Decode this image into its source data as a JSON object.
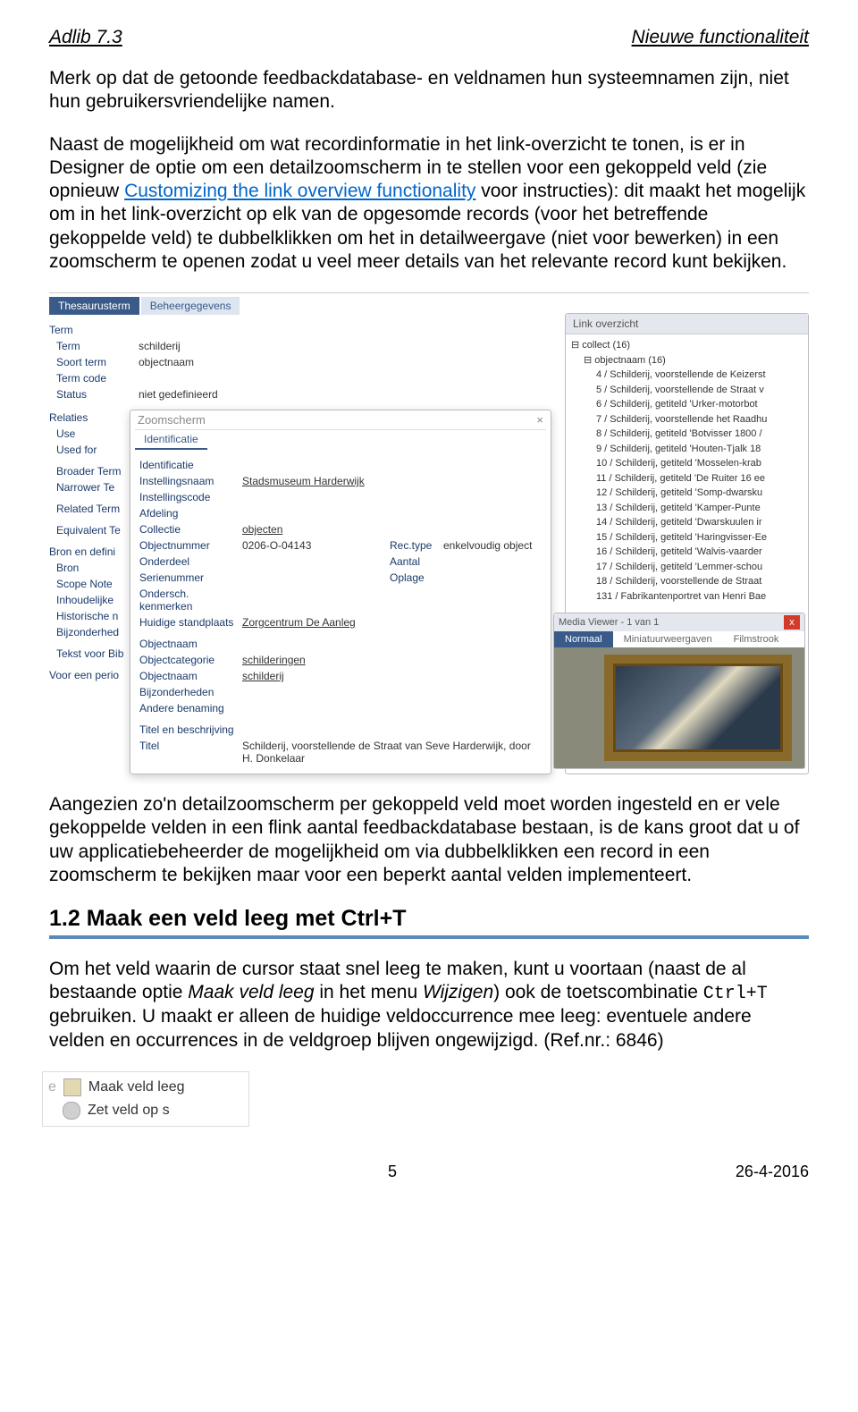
{
  "header": {
    "left": "Adlib 7.3",
    "right": "Nieuwe functionaliteit"
  },
  "paragraph1": "Merk op dat de getoonde feedbackdatabase- en veldnamen hun systeemnamen zijn, niet hun gebruikersvriendelijke namen.",
  "p2a": "Naast de mogelijkheid om wat recordinformatie in het link-overzicht te tonen, is er in Designer de optie om een detailzoomscherm in te stellen voor een gekoppeld veld (zie opnieuw ",
  "p2link": "Customizing the link overview functionality",
  "p2b": " voor instructies): dit maakt het mogelijk om in het link-overzicht op elk van de opgesomde records (voor het betreffende gekoppelde veld) te dubbelklikken om het in detailweergave (niet voor bewerken) in een zoomscherm te openen zodat u veel meer details van het relevante record kunt bekijken.",
  "screenshot": {
    "tab1": "Thesaurusterm",
    "tab2": "Beheergegevens",
    "leftLabels": {
      "l0": "Term",
      "l1": "Term",
      "l2": "Soort term",
      "l3": "Term code",
      "l4": "Status",
      "l5": "Relaties",
      "l6": "Use",
      "l7": "Used for",
      "l8": "Broader Term",
      "l9": "Narrower Te",
      "l10": "Related Term",
      "l11": "Equivalent Te",
      "l12": "Bron en defini",
      "l13": "Bron",
      "l14": "Scope Note",
      "l15": "Inhoudelijke",
      "l16": "Historische n",
      "l17": "Bijzonderhed",
      "l18": "Tekst voor Bib",
      "l19": "Voor een perio"
    },
    "midVals": {
      "v0": "schilderij",
      "v1": "objectnaam",
      "v2": "niet gedefinieerd"
    },
    "zoom": {
      "title": "Zoomscherm",
      "tab": "Identificatie",
      "row0": {
        "label": "Identificatie"
      },
      "row1": {
        "label": "Instellingsnaam",
        "val": "Stadsmuseum Harderwijk"
      },
      "row2": {
        "label": "Instellingscode"
      },
      "row3": {
        "label": "Afdeling"
      },
      "row4": {
        "label": "Collectie",
        "val": "objecten"
      },
      "row5": {
        "label": "Objectnummer",
        "val": "0206-O-04143",
        "l2": "Rec.type",
        "v2": "enkelvoudig object"
      },
      "row6": {
        "label": "Onderdeel",
        "l2": "Aantal"
      },
      "row7": {
        "label": "Serienummer",
        "l2": "Oplage"
      },
      "row8": {
        "label": "Ondersch. kenmerken"
      },
      "row9": {
        "label": "Huidige standplaats",
        "val": "Zorgcentrum De Aanleg"
      },
      "row10": {
        "label": "Objectnaam"
      },
      "row11": {
        "label": "Objectcategorie",
        "val": "schilderingen"
      },
      "row12": {
        "label": "Objectnaam",
        "val": "schilderij"
      },
      "row13": {
        "label": "Bijzonderheden"
      },
      "row14": {
        "label": "Andere benaming"
      },
      "row15": {
        "label": "Titel en beschrijving"
      },
      "row16": {
        "label": "Titel",
        "val": "Schilderij, voorstellende de Straat van Seve Harderwijk, door H. Donkelaar"
      }
    },
    "panelHead": "Link overzicht",
    "tree": {
      "r0": "collect (16)",
      "r1": "objectnaam (16)",
      "i0": "4 / Schilderij, voorstellende de Keizerst",
      "i1": "5 / Schilderij, voorstellende de Straat v",
      "i2": "6 / Schilderij, getiteld 'Urker-motorbot",
      "i3": "7 / Schilderij, voorstellende het Raadhu",
      "i4": "8 / Schilderij, getiteld 'Botvisser 1800 /",
      "i5": "9 / Schilderij, getiteld 'Houten-Tjalk 18",
      "i6": "10 / Schilderij, getiteld 'Mosselen-krab",
      "i7": "11 / Schilderij, getiteld 'De Ruiter 16 ee",
      "i8": "12 / Schilderij, getiteld 'Somp-dwarsku",
      "i9": "13 / Schilderij, getiteld 'Kamper-Punte",
      "i10": "14 / Schilderij, getiteld 'Dwarskuulen ir",
      "i11": "15 / Schilderij, getiteld 'Haringvisser-Ee",
      "i12": "16 / Schilderij, getiteld 'Walvis-vaarder",
      "i13": "17 / Schilderij, getiteld 'Lemmer-schou",
      "i14": "18 / Schilderij, voorstellende de Straat",
      "i15": "131 / Fabrikantenportret van Henri Bae"
    },
    "mv": {
      "title": "Media Viewer - 1 van 1",
      "t1": "Normaal",
      "t2": "Miniatuurweergaven",
      "t3": "Filmstrook"
    }
  },
  "paragraph3": "Aangezien zo'n detailzoomscherm per gekoppeld veld moet worden ingesteld en er vele gekoppelde velden in een flink aantal feedbackdatabase bestaan, is de kans groot dat u of uw applicatiebeheerder de mogelijkheid om via dubbelklikken een record in een zoomscherm te bekijken maar voor een beperkt aantal velden implementeert.",
  "section12": {
    "title": "1.2 Maak een veld leeg met Ctrl+T"
  },
  "p4a": "Om het veld waarin de cursor staat snel leeg te maken, kunt u voortaan (naast de al bestaande optie ",
  "p4i": "Maak veld leeg",
  "p4b": " in het menu ",
  "p4i2": "Wijzigen",
  "p4c": ") ook de toetscombinatie ",
  "p4code": "Ctrl+T",
  "p4d": " gebruiken. U maakt er alleen de huidige veldoccurrence mee leeg: eventuele andere velden en occurrences in de veldgroep blijven ongewijzigd. (Ref.nr.: 6846)",
  "menu": {
    "m1": "Maak veld leeg",
    "m2": "Zet veld op s"
  },
  "footer": {
    "pagenum": "5",
    "date": "26-4-2016"
  }
}
